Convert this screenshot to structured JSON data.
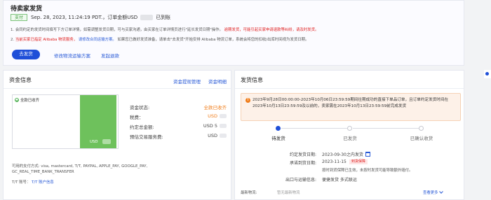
{
  "order_status": {
    "title": "待卖家发货",
    "paid_badge": "支付",
    "paid_text_prefix": "Sep. 28, 2023, 11:24:19 PDT.，订单金额USD",
    "paid_text_suffix": "已到账",
    "notes": [
      {
        "num": "1.",
        "text": "会同约定的发货时间填写下方订单详情，如需调整发货日期，可与买家沟通，由买家在订单详情页进行\"延长发货日期\"操作。",
        "red": "逾期发货，可能引起买家申请退款等纠纷，请及时发货。",
        "blue": ""
      },
      {
        "num": "2.",
        "text": "",
        "red": "当前买家已指定 Alibaba 物流服务，",
        "blue": "请修改合同运输方案。",
        "text2": "如果您已做好发货准备，请单击\"去发货\"开始安排 Alibaba 物流订单，系统会将您的扣收/出库时间视为发货日期。"
      }
    ],
    "ship_button": "去发货",
    "modify_link": "修改物流运输方案",
    "refund_link": "发起退款"
  },
  "fund_info": {
    "title": "资金信息",
    "link_withdraw": "资金提现管理",
    "link_detail": "资金明细",
    "chart_legend": "全款已收齐",
    "chart_bar_label": "USD",
    "rows": [
      {
        "label": "资金状态:",
        "value": "全款已收齐",
        "color": "orange"
      },
      {
        "label": "税费：",
        "value": "USD",
        "color": "orange"
      },
      {
        "label": "约定总金额:",
        "value": "USD 5",
        "color": "dark"
      },
      {
        "label": "预估交易服务费:",
        "value": "USD",
        "color": "dark"
      }
    ],
    "payment_methods_line1": "可用的支付方式: visa, mastercard, T/T, PAYPAL, APPLE_PAY, GOOGLE_PAY,",
    "payment_methods_line2": "GC_REAL_TIME_BANK_TRANSFER",
    "tt_label": "T/T 账号：",
    "tt_link": "T/T 账户信息"
  },
  "shipping_info": {
    "title": "发货信息",
    "alert_text": "2023年9月28日00:00:00-2023年10月06日23:59:59期间往期成功的直接下单品订单，且订单约定发货时间在2023年10月13日23:59:59及以前的，卖家需在2023年10月13日23:59:59前完成发货",
    "steps": [
      {
        "label": "待发货",
        "active": true
      },
      {
        "label": "已发货",
        "active": false
      },
      {
        "label": "已确认收货",
        "active": false
      }
    ],
    "promised_date_label": "约定发货日期:",
    "promised_date_value": "2023-09-30之内发货",
    "promise_date_label": "承诺到货日期:",
    "promise_date_value": "2023-11-15",
    "promise_badge": "到货保障",
    "promise_note": "按时到货保障已生效，未按时发货可能导致额外赔付。",
    "port_label": "出口与运输信息:",
    "port_value": "便捷发货  多式联运",
    "latest_label": "最新物流:",
    "latest_value": "暂无最新物流",
    "see_more": "查看更多"
  }
}
